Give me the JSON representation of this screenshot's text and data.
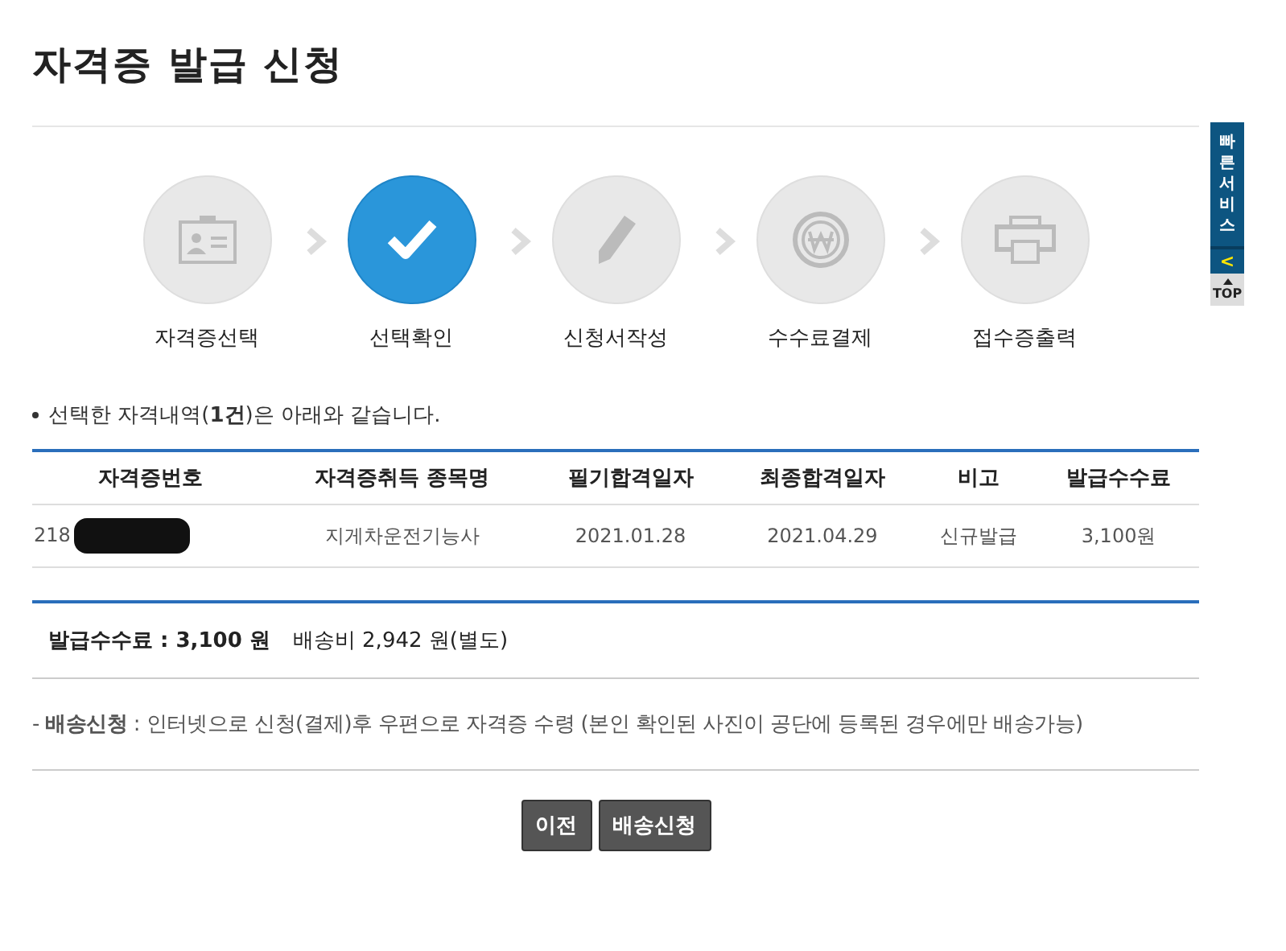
{
  "page_title": "자격증 발급 신청",
  "steps": [
    {
      "label": "자격증선택",
      "kind": "id-card",
      "selected": false
    },
    {
      "label": "선택확인",
      "kind": "check",
      "selected": true
    },
    {
      "label": "신청서작성",
      "kind": "pencil",
      "selected": false
    },
    {
      "label": "수수료결제",
      "kind": "coin",
      "selected": false
    },
    {
      "label": "접수증출력",
      "kind": "printer",
      "selected": false
    }
  ],
  "notice": "선택한 자격내역(**1건**)은 아래와 같습니다.",
  "table": {
    "columns": [
      "자격증번호",
      "자격증취득 종목명",
      "필기합격일자",
      "최종합격일자",
      "비고",
      "발급수수료"
    ],
    "rows": [
      {
        "cells": [
          "218",
          "지게차운전기능사",
          "2021.01.28",
          "2021.04.29",
          "신규발급",
          "3,100원"
        ],
        "redacted": true
      }
    ]
  },
  "fee_summary": {
    "fee": "발급수수료 : 3,100 원",
    "shipping": "배송비 2,942 원(별도)"
  },
  "delivery_note": "- **배송신청** : 인터넷으로 신청(결제)후 우편으로 자격증 수령 (본인 확인된 사진이 공단에 등록된 경우에만 배송가능)",
  "buttons": [
    "이전",
    "배송신청"
  ],
  "quick_service": {
    "label": "빠른서비스",
    "collapse": "<",
    "top": "TOP"
  }
}
